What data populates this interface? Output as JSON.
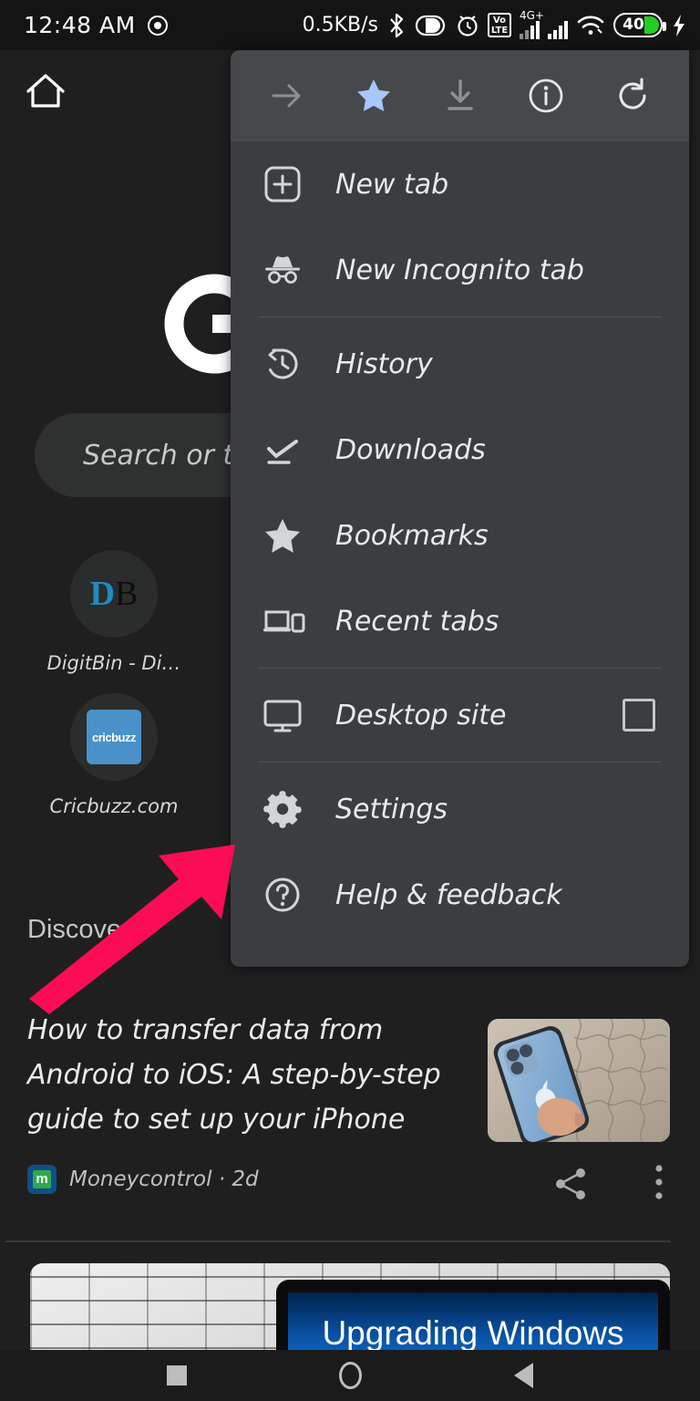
{
  "status_bar": {
    "clock": "12:48 AM",
    "network_speed": "0.5KB/s",
    "volte_top": "Vo",
    "volte_bottom": "LTE",
    "network_label": "4G+",
    "battery_level": "40",
    "icons": [
      "screen-record-icon",
      "bluetooth-icon",
      "dnd-icon",
      "alarm-icon",
      "volte-icon",
      "signal-sim1-icon",
      "signal-sim2-icon",
      "wifi-icon",
      "battery-icon",
      "charging-bolt-icon"
    ]
  },
  "ntp": {
    "home_icon": "home-icon",
    "logo": "google-g-logo",
    "search_placeholder": "Search or type",
    "shortcuts": [
      {
        "label": "DigitBin - Di…",
        "logo_text_blue": "D",
        "logo_text_dark": "B"
      },
      {
        "label": "Cricbuzz.com",
        "logo_text": "cricbuzz"
      }
    ],
    "discover_heading": "Discover",
    "articles": [
      {
        "title": "How to transfer data from Android to iOS: A step-by-step guide to set up your iPhone",
        "source": "Moneycontrol · 2d",
        "favicon_letter": "m",
        "thumbnail_alt": "blue-iphone-in-hand-photo"
      },
      {
        "thumbnail_caption": "Upgrading Windows",
        "thumbnail_alt": "monitor-on-white-brick-wall-photo"
      }
    ]
  },
  "menu": {
    "header_buttons": [
      {
        "name": "forward-arrow-icon",
        "state": "disabled"
      },
      {
        "name": "star-icon",
        "state": "active",
        "color": "#A8C7FA"
      },
      {
        "name": "download-icon",
        "state": "disabled"
      },
      {
        "name": "page-info-icon",
        "state": "enabled"
      },
      {
        "name": "reload-icon",
        "state": "enabled"
      }
    ],
    "items": [
      {
        "label": "New tab",
        "icon": "new-tab-icon"
      },
      {
        "label": "New Incognito tab",
        "icon": "incognito-icon"
      },
      {
        "label": "History",
        "icon": "history-icon"
      },
      {
        "label": "Downloads",
        "icon": "downloads-icon"
      },
      {
        "label": "Bookmarks",
        "icon": "bookmarks-star-icon"
      },
      {
        "label": "Recent tabs",
        "icon": "recent-tabs-icon"
      },
      {
        "label": "Desktop site",
        "icon": "desktop-site-icon",
        "checkbox": "unchecked"
      },
      {
        "label": "Settings",
        "icon": "gear-icon"
      },
      {
        "label": "Help & feedback",
        "icon": "help-circle-icon"
      }
    ]
  },
  "annotation": {
    "arrow_color": "#FA0D55",
    "points_to": "Settings"
  },
  "nav_bar": {
    "recents": "square-recents-icon",
    "home": "circle-home-icon",
    "back": "triangle-back-icon"
  },
  "colors": {
    "menu_bg": "#3B3D40",
    "menu_header_bg": "#46484B",
    "page_bg": "#1F1F1F",
    "status_bar_bg": "#141414",
    "accent_star": "#A8C7FA",
    "battery_green": "#22CC22",
    "annotation_pink": "#FA0D55"
  }
}
